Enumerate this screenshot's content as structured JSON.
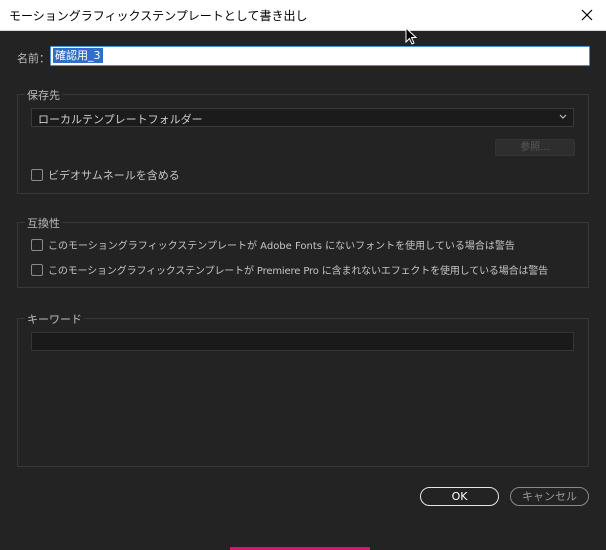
{
  "window": {
    "title": "モーショングラフィックステンプレートとして書き出し"
  },
  "name": {
    "label": "名前：",
    "value": "確認用_3"
  },
  "destination": {
    "group_label": "保存先",
    "selected": "ローカルテンプレートフォルダー",
    "browse_label": "参照...",
    "include_video_thumbnail_label": "ビデオサムネールを含める"
  },
  "compatibility": {
    "group_label": "互換性",
    "adobe_fonts_warning_label": "このモーショングラフィックステンプレートが Adobe Fonts にないフォントを使用している場合は警告",
    "premiere_effects_warning_label": "このモーショングラフィックステンプレートが Premiere Pro に含まれないエフェクトを使用している場合は警告"
  },
  "keywords": {
    "group_label": "キーワード",
    "value": ""
  },
  "buttons": {
    "ok_label": "OK",
    "cancel_label": "キャンセル"
  }
}
